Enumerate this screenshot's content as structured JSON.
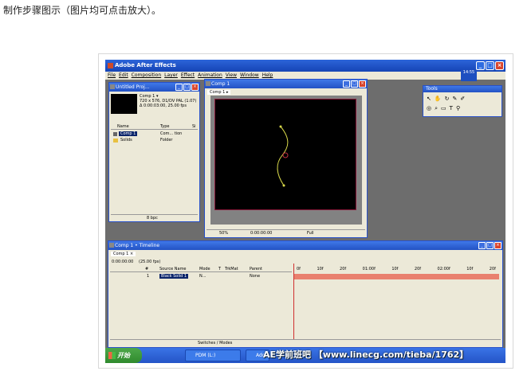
{
  "caption": "制作步骤图示（图片均可点击放大）。",
  "app": {
    "title": "Adobe After Effects",
    "menu": [
      "File",
      "Edit",
      "Composition",
      "Layer",
      "Effect",
      "Animation",
      "View",
      "Window",
      "Help"
    ]
  },
  "project_panel": {
    "title": "Untitled Proj...",
    "comp_name": "Comp 1 ▾",
    "comp_info_1": "720 x 576, D1/DV PAL (1.07)",
    "comp_info_2": "Δ 0:00:03:00, 25.00 fps",
    "columns": [
      "Name",
      "Type",
      "Si"
    ],
    "rows": [
      {
        "name": "Comp 1",
        "type": "Com... tion"
      },
      {
        "name": "Solids",
        "type": "Folder"
      }
    ],
    "bpc": "8 bpc"
  },
  "comp_panel": {
    "title": "Comp 1",
    "tab": "Comp 1 ▸",
    "zoom": "50%",
    "timecode": "0:00:00:00",
    "resolution": "Full"
  },
  "tools_panel": {
    "title": "Tools"
  },
  "timeline": {
    "title": "Comp 1 • Timeline",
    "tab": "Comp 1 ×",
    "timecode": "0:00:00:00",
    "fps": "(25.00 fps)",
    "columns": [
      "#",
      "Source Name",
      "Mode",
      "T",
      "TrkMat",
      "Parent"
    ],
    "layer": {
      "index": "1",
      "source": "Black Solid 1",
      "mode": "N...",
      "parent": "None"
    },
    "ruler": [
      "0f",
      "10f",
      "20f",
      "01:00f",
      "10f",
      "20f",
      "02:00f",
      "10f",
      "20f"
    ],
    "switches_label": "Switches / Modes"
  },
  "taskbar": {
    "start_label": "开始",
    "items": [
      "PDM (L:)",
      "Ado..."
    ],
    "clock": "14:55"
  },
  "watermark": "AE学前班吧 【www.linecg.com/tieba/1762】",
  "colors": {
    "titlebar": "#1d4fc0",
    "layer_bar": "#e9806e",
    "path": "#d8d84a"
  }
}
